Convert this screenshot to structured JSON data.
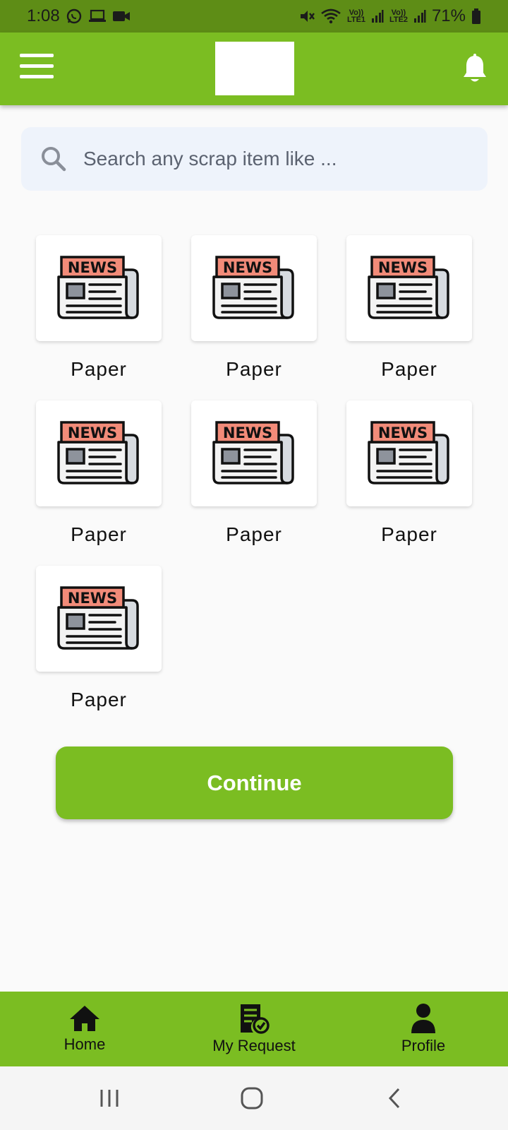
{
  "status_bar": {
    "time": "1:08",
    "volte1": "Vo)) LTE1",
    "volte2": "Vo)) LTE2",
    "battery": "71%"
  },
  "app_bar": {
    "menu_icon": "hamburger-menu-icon",
    "notification_icon": "bell-icon"
  },
  "search": {
    "placeholder": "Search any scrap item like ..."
  },
  "items": [
    {
      "label": "Paper",
      "icon": "newspaper-icon"
    },
    {
      "label": "Paper",
      "icon": "newspaper-icon"
    },
    {
      "label": "Paper",
      "icon": "newspaper-icon"
    },
    {
      "label": "Paper",
      "icon": "newspaper-icon"
    },
    {
      "label": "Paper",
      "icon": "newspaper-icon"
    },
    {
      "label": "Paper",
      "icon": "newspaper-icon"
    },
    {
      "label": "Paper",
      "icon": "newspaper-icon"
    }
  ],
  "news_badge_text": "NEWS",
  "continue_label": "Continue",
  "bottom_nav": {
    "home": "Home",
    "request": "My Request",
    "profile": "Profile"
  },
  "colors": {
    "primary": "#7bbd22",
    "status_bar": "#5e8d16",
    "search_bg": "#eef3fb",
    "news_red": "#f28b79"
  }
}
